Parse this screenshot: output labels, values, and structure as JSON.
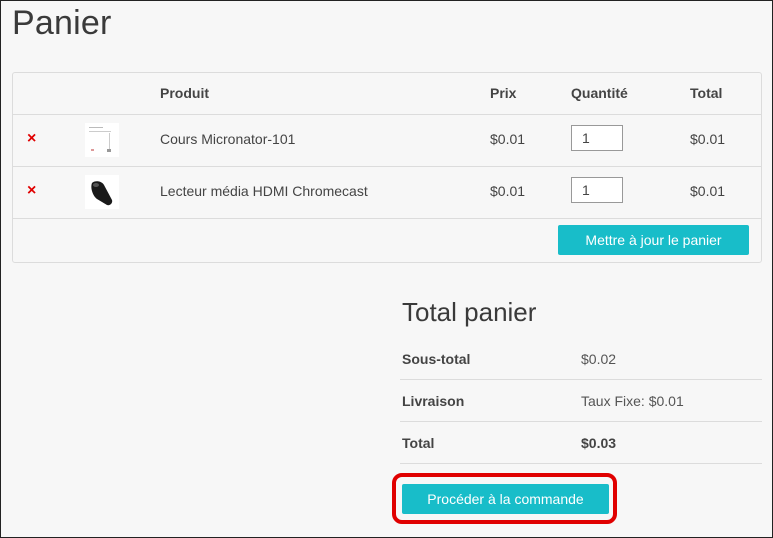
{
  "page": {
    "title": "Panier"
  },
  "cart": {
    "headers": {
      "product": "Produit",
      "price": "Prix",
      "quantity": "Quantité",
      "total": "Total"
    },
    "items": [
      {
        "remove_glyph": "×",
        "thumbnail_icon": "document-thumbnail-icon",
        "name": "Cours Micronator-101",
        "price": "$0.01",
        "quantity": "1",
        "total": "$0.01"
      },
      {
        "remove_glyph": "×",
        "thumbnail_icon": "chromecast-thumbnail-icon",
        "name": "Lecteur média HDMI Chromecast",
        "price": "$0.01",
        "quantity": "1",
        "total": "$0.01"
      }
    ],
    "update_button": "Mettre à jour le panier"
  },
  "totals": {
    "title": "Total panier",
    "rows": [
      {
        "label": "Sous-total",
        "value": "$0.02"
      },
      {
        "label": "Livraison",
        "value": "Taux Fixe: $0.01"
      },
      {
        "label": "Total",
        "value": "$0.03"
      }
    ],
    "checkout_button": "Procéder à la commande"
  },
  "colors": {
    "accent": "#18bdc9",
    "remove": "#e00000",
    "highlight": "#e00000"
  }
}
